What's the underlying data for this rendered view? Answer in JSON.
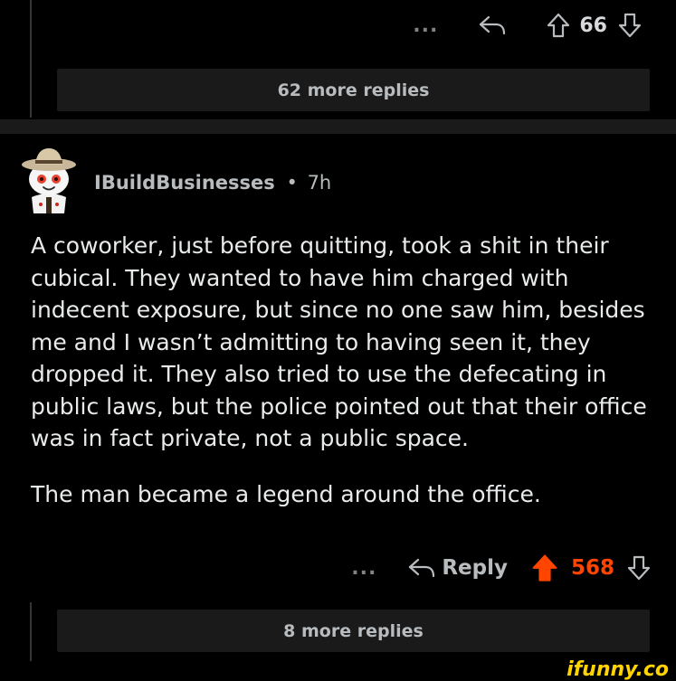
{
  "top_comment": {
    "more_label": "...",
    "vote_count": "66",
    "replies_label": "62 more replies"
  },
  "main_comment": {
    "username": "IBuildBusinesses",
    "separator": "•",
    "age": "7h",
    "paragraphs": [
      "A coworker, just before quitting, took a shit in their cubical. They wanted to have him charged with indecent exposure, but since no one saw him, besides me and I wasn’t admitting to having seen it, they dropped it. They also tried to use the defecating in public laws, but the police pointed out that their office was in fact private, not a public space.",
      "The man became a legend around the office."
    ],
    "more_label": "...",
    "reply_label": "Reply",
    "vote_count": "568",
    "upvote_color": "#ff4500",
    "replies_label": "8 more replies"
  },
  "watermark": {
    "text": "ifunny.co",
    "color": "#ffd400"
  },
  "icons": [
    "more-icon",
    "reply-icon",
    "upvote-icon",
    "downvote-icon",
    "avatar-icon"
  ]
}
